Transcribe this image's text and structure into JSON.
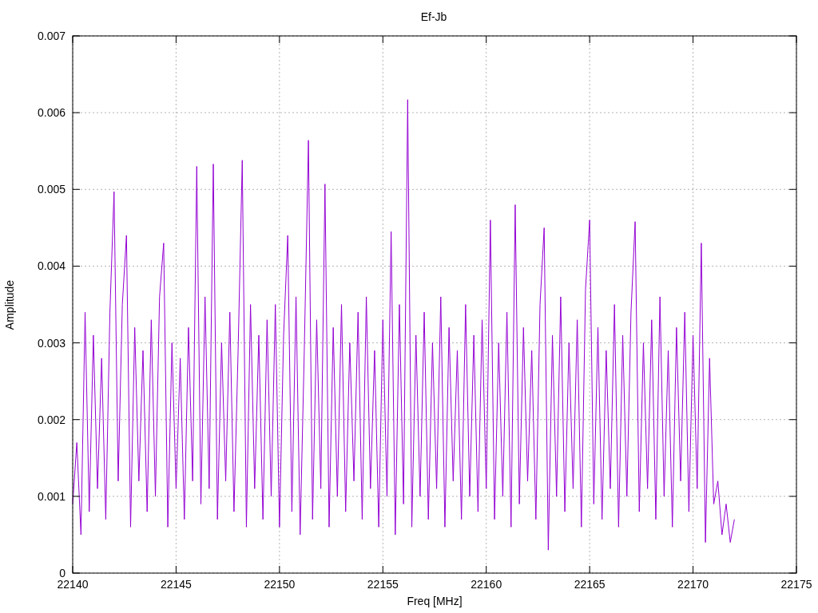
{
  "chart_data": {
    "type": "line",
    "title": "Ef-Jb",
    "xlabel": "Freq [MHz]",
    "ylabel": "Amplitude",
    "xlim": [
      22140,
      22175
    ],
    "ylim": [
      0,
      0.007
    ],
    "xticks": [
      {
        "value": 22140,
        "label": "22140"
      },
      {
        "value": 22145,
        "label": "22145"
      },
      {
        "value": 22150,
        "label": "22150"
      },
      {
        "value": 22155,
        "label": "22155"
      },
      {
        "value": 22160,
        "label": "22160"
      },
      {
        "value": 22165,
        "label": "22165"
      },
      {
        "value": 22170,
        "label": "22170"
      },
      {
        "value": 22175,
        "label": "22175"
      }
    ],
    "yticks": [
      {
        "value": 0,
        "label": "0"
      },
      {
        "value": 0.001,
        "label": "0.001"
      },
      {
        "value": 0.002,
        "label": "0.002"
      },
      {
        "value": 0.003,
        "label": "0.003"
      },
      {
        "value": 0.004,
        "label": "0.004"
      },
      {
        "value": 0.005,
        "label": "0.005"
      },
      {
        "value": 0.006,
        "label": "0.006"
      },
      {
        "value": 0.007,
        "label": "0.007"
      }
    ],
    "grid": true,
    "x": [
      22140,
      22140.2,
      22140.4,
      22140.6,
      22140.8,
      22141,
      22141.2,
      22141.4,
      22141.6,
      22141.8,
      22142,
      22142.2,
      22142.4,
      22142.6,
      22142.8,
      22143,
      22143.2,
      22143.4,
      22143.6,
      22143.8,
      22144,
      22144.2,
      22144.4,
      22144.6,
      22144.8,
      22145,
      22145.2,
      22145.4,
      22145.6,
      22145.8,
      22146,
      22146.2,
      22146.4,
      22146.6,
      22146.8,
      22147,
      22147.2,
      22147.4,
      22147.6,
      22147.8,
      22148,
      22148.2,
      22148.4,
      22148.6,
      22148.8,
      22149,
      22149.2,
      22149.4,
      22149.6,
      22149.8,
      22150,
      22150.2,
      22150.4,
      22150.6,
      22150.8,
      22151,
      22151.2,
      22151.4,
      22151.6,
      22151.8,
      22152,
      22152.2,
      22152.4,
      22152.6,
      22152.8,
      22153,
      22153.2,
      22153.4,
      22153.6,
      22153.8,
      22154,
      22154.2,
      22154.4,
      22154.6,
      22154.8,
      22155,
      22155.2,
      22155.4,
      22155.6,
      22155.8,
      22156,
      22156.2,
      22156.4,
      22156.6,
      22156.8,
      22157,
      22157.2,
      22157.4,
      22157.6,
      22157.8,
      22158,
      22158.2,
      22158.4,
      22158.6,
      22158.8,
      22159,
      22159.2,
      22159.4,
      22159.6,
      22159.8,
      22160,
      22160.2,
      22160.4,
      22160.6,
      22160.8,
      22161,
      22161.2,
      22161.4,
      22161.6,
      22161.8,
      22162,
      22162.2,
      22162.4,
      22162.6,
      22162.8,
      22163,
      22163.2,
      22163.4,
      22163.6,
      22163.8,
      22164,
      22164.2,
      22164.4,
      22164.6,
      22164.8,
      22165,
      22165.2,
      22165.4,
      22165.6,
      22165.8,
      22166,
      22166.2,
      22166.4,
      22166.6,
      22166.8,
      22167,
      22167.2,
      22167.4,
      22167.6,
      22167.8,
      22168,
      22168.2,
      22168.4,
      22168.6,
      22168.8,
      22169,
      22169.2,
      22169.4,
      22169.6,
      22169.8,
      22170,
      22170.2,
      22170.4,
      22170.6,
      22170.8,
      22171,
      22171.2,
      22171.4,
      22171.6,
      22171.8,
      22172
    ],
    "series": [
      {
        "color": "#9400d3",
        "values": [
          0.0009,
          0.0017,
          0.0005,
          0.0034,
          0.0008,
          0.0031,
          0.0011,
          0.0028,
          0.0007,
          0.0034,
          0.00497,
          0.0012,
          0.0035,
          0.0044,
          0.0006,
          0.0032,
          0.0012,
          0.0029,
          0.0008,
          0.0033,
          0.001,
          0.0036,
          0.0043,
          0.0006,
          0.003,
          0.0011,
          0.0028,
          0.0007,
          0.0032,
          0.0012,
          0.0053,
          0.0009,
          0.0036,
          0.0011,
          0.00533,
          0.0007,
          0.003,
          0.0012,
          0.0034,
          0.0008,
          0.0029,
          0.00538,
          0.0006,
          0.0035,
          0.0011,
          0.0031,
          0.0007,
          0.0033,
          0.001,
          0.0035,
          0.0006,
          0.0031,
          0.0044,
          0.0008,
          0.0036,
          0.0005,
          0.0029,
          0.00564,
          0.0007,
          0.0033,
          0.0011,
          0.00507,
          0.0006,
          0.0032,
          0.001,
          0.0035,
          0.0008,
          0.003,
          0.0012,
          0.0034,
          0.0007,
          0.0036,
          0.0011,
          0.0029,
          0.0006,
          0.0033,
          0.001,
          0.00445,
          0.0005,
          0.0035,
          0.0009,
          0.00617,
          0.0006,
          0.0031,
          0.001,
          0.0034,
          0.0007,
          0.003,
          0.0011,
          0.0036,
          0.0006,
          0.0032,
          0.0012,
          0.0029,
          0.0007,
          0.0035,
          0.001,
          0.0031,
          0.0008,
          0.0033,
          0.0011,
          0.0046,
          0.0007,
          0.003,
          0.001,
          0.0034,
          0.0006,
          0.0048,
          0.0009,
          0.0032,
          0.0012,
          0.0029,
          0.0007,
          0.0035,
          0.0045,
          0.0003,
          0.0031,
          0.001,
          0.0036,
          0.0008,
          0.003,
          0.0011,
          0.0033,
          0.0006,
          0.0037,
          0.0046,
          0.0009,
          0.0032,
          0.0007,
          0.0029,
          0.0011,
          0.0035,
          0.0006,
          0.0031,
          0.001,
          0.0034,
          0.00458,
          0.0008,
          0.003,
          0.0011,
          0.0033,
          0.0007,
          0.0036,
          0.001,
          0.0029,
          0.0006,
          0.0032,
          0.0012,
          0.0034,
          0.0008,
          0.0031,
          0.0011,
          0.0043,
          0.0004,
          0.0028,
          0.0009,
          0.0012,
          0.0005,
          0.0009,
          0.0004,
          0.0007
        ]
      }
    ]
  }
}
